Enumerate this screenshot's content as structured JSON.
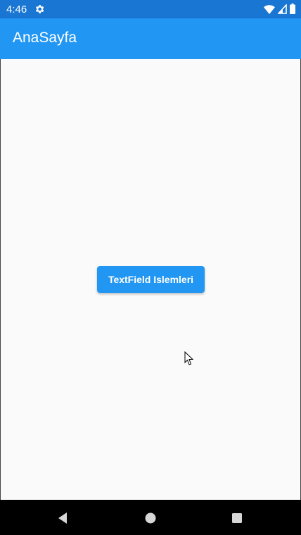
{
  "status_bar": {
    "time": "4:46",
    "icons": [
      "gear-icon",
      "wifi-icon",
      "signal-icon",
      "battery-icon"
    ],
    "color": "#1976d2"
  },
  "app_bar": {
    "title": "AnaSayfa",
    "color": "#2196f3"
  },
  "main": {
    "button_label": "TextField Islemleri",
    "background": "#fafafa"
  },
  "nav_bar": {
    "icons": [
      "back-icon",
      "home-icon",
      "recents-icon"
    ]
  }
}
